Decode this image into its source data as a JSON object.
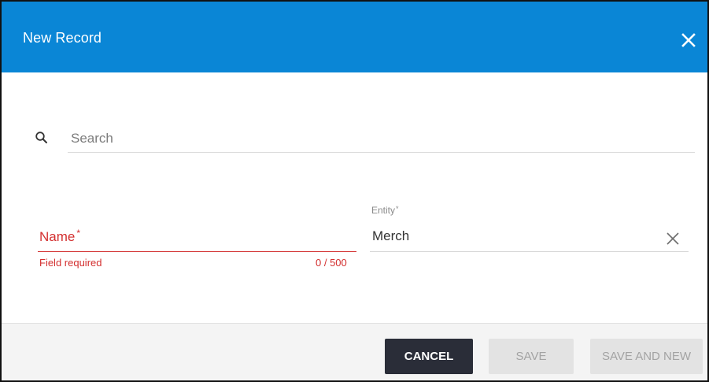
{
  "dialog": {
    "title": "New Record",
    "close_icon": "close-icon"
  },
  "search": {
    "icon": "search-icon",
    "placeholder": "Search",
    "value": ""
  },
  "form": {
    "name": {
      "label": "Name",
      "required_mark": "*",
      "value": "",
      "error": "Field required",
      "counter": "0 / 500",
      "error_color": "#d32f2f"
    },
    "entity": {
      "label": "Entity",
      "required_mark": "*",
      "value": "Merch",
      "clear_icon": "close-icon"
    }
  },
  "footer": {
    "cancel_label": "CANCEL",
    "save_label": "SAVE",
    "save_new_label": "SAVE AND NEW"
  },
  "colors": {
    "header": "#0a86d6",
    "primary_button": "#2a2d38",
    "disabled_button": "#e3e3e3",
    "error": "#d32f2f"
  }
}
